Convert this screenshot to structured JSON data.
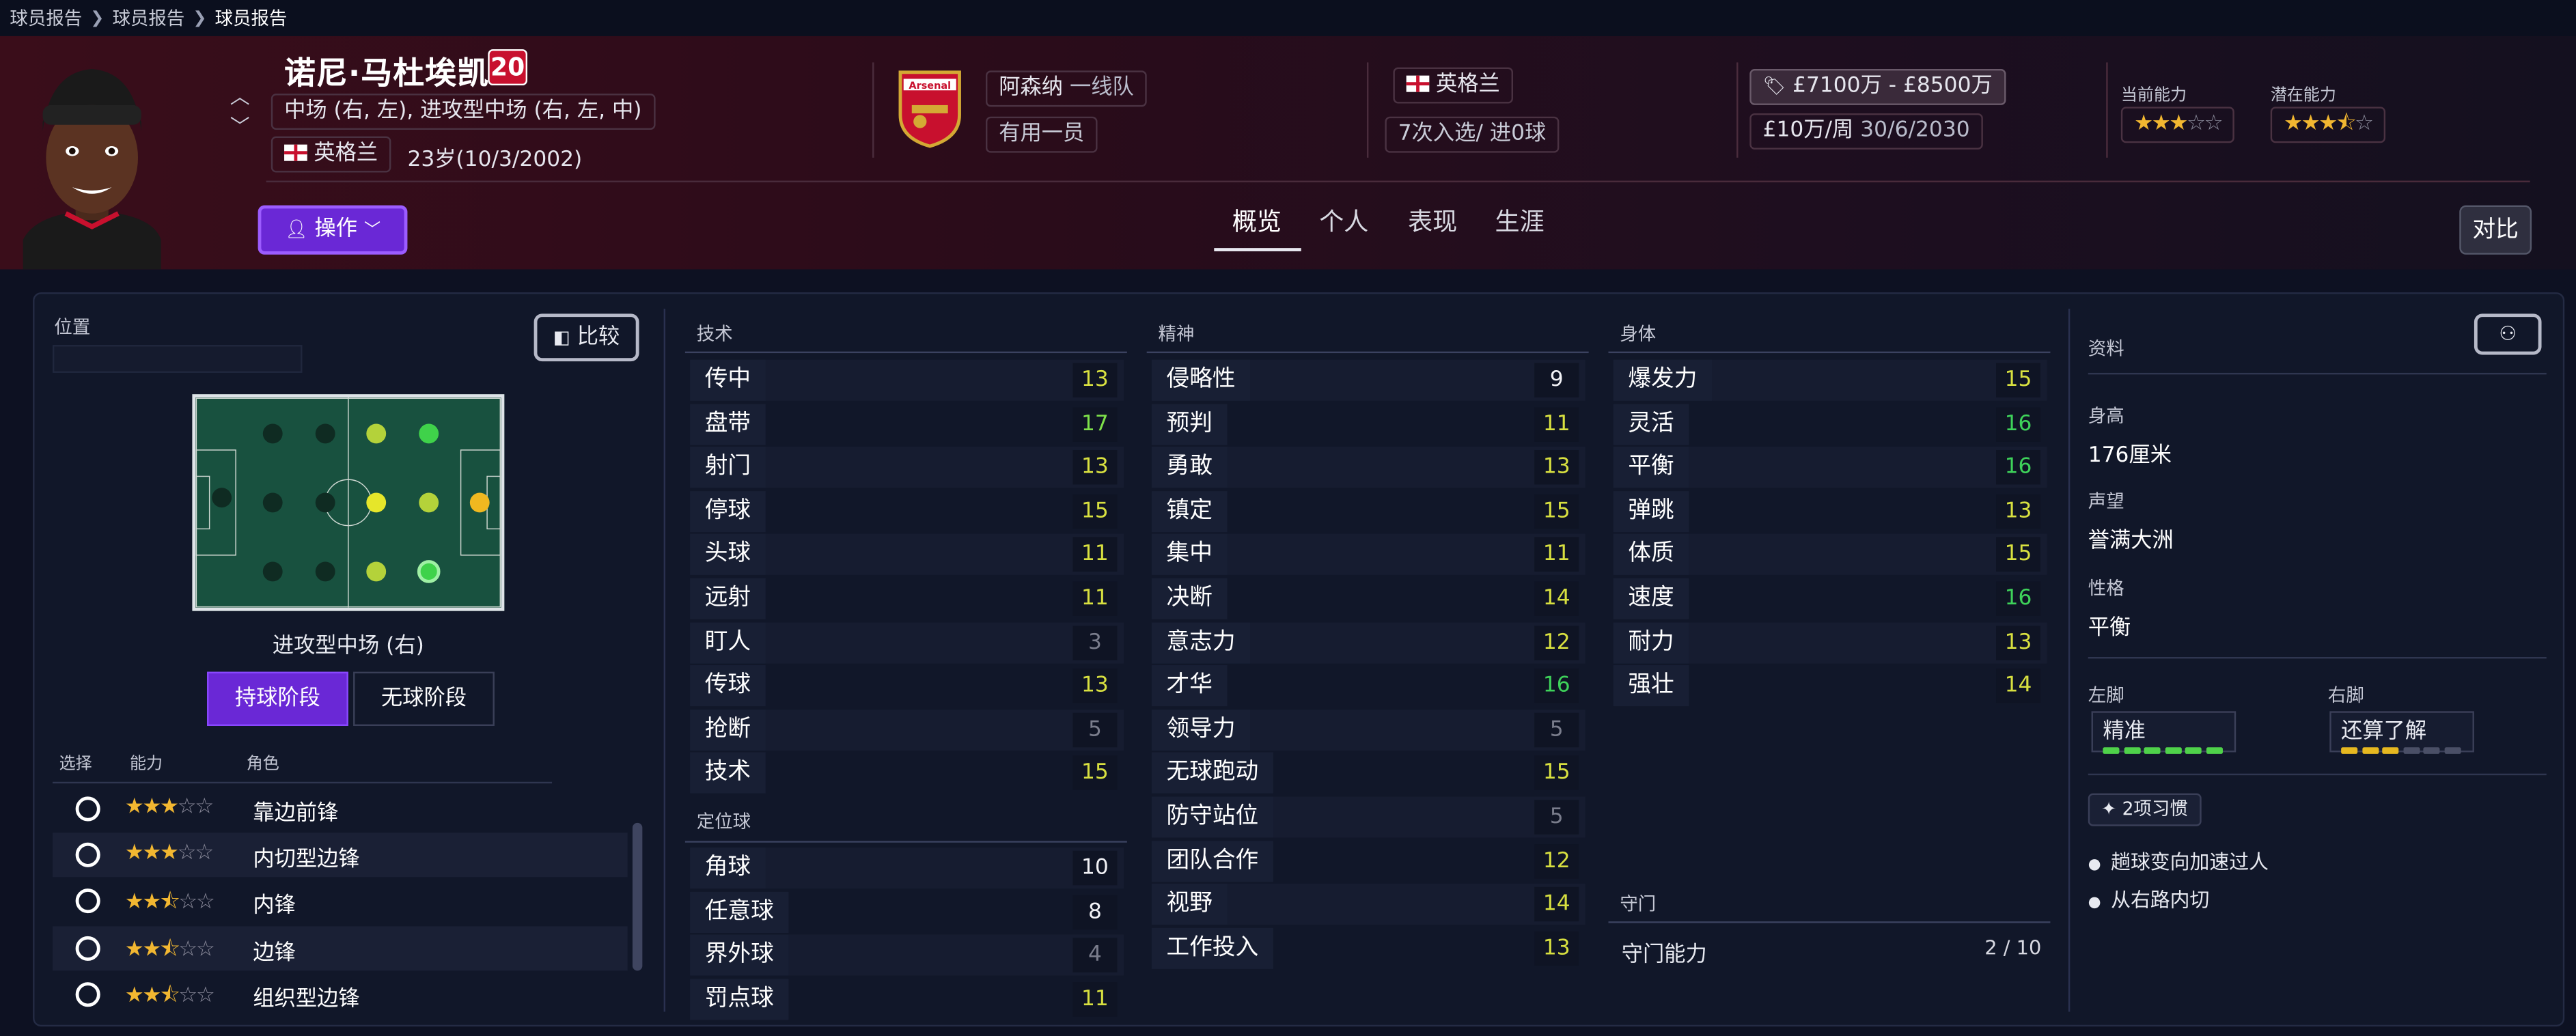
{
  "breadcrumb": [
    "球员报告",
    "球员报告",
    "球员报告"
  ],
  "player": {
    "name": "诺尼·马杜埃凯",
    "number": "20",
    "positions": "中场 (右, 左), 进攻型中场 (右, 左, 中)",
    "nationality": "英格兰",
    "age_dob": "23岁(10/3/2002)",
    "action_label": "操作"
  },
  "club": {
    "name": "阿森纳",
    "squad": "一线队",
    "role": "有用一员",
    "badge_text": "Arsenal"
  },
  "international": {
    "nation": "英格兰",
    "caps": "7次入选/ 进0球"
  },
  "value": {
    "range": "£7100万 - £8500万",
    "wage": "£10万/周",
    "contract_end": "30/6/2030"
  },
  "ability": {
    "current_label": "当前能力",
    "potential_label": "潜在能力",
    "current_stars": 3,
    "potential_stars": 3.5
  },
  "tabs": [
    "概览",
    "个人",
    "表现",
    "生涯"
  ],
  "compare_label": "对比",
  "position_panel": {
    "title": "位置",
    "compare_btn": "比较",
    "selected_position": "进攻型中场 (右)",
    "phase_in": "持球阶段",
    "phase_out": "无球阶段",
    "col_select": "选择",
    "col_ability": "能力",
    "col_role": "角色",
    "roles": [
      {
        "name": "靠边前锋",
        "stars": 3
      },
      {
        "name": "内切型边锋",
        "stars": 3
      },
      {
        "name": "内锋",
        "stars": 2.5
      },
      {
        "name": "边锋",
        "stars": 2.5
      },
      {
        "name": "组织型边锋",
        "stars": 2.5
      }
    ]
  },
  "technical": {
    "title": "技术",
    "items": [
      {
        "name": "传中",
        "value": "13",
        "tier": "y"
      },
      {
        "name": "盘带",
        "value": "17",
        "tier": "lg"
      },
      {
        "name": "射门",
        "value": "13",
        "tier": "y"
      },
      {
        "name": "停球",
        "value": "15",
        "tier": "y"
      },
      {
        "name": "头球",
        "value": "11",
        "tier": "y"
      },
      {
        "name": "远射",
        "value": "11",
        "tier": "y"
      },
      {
        "name": "盯人",
        "value": "3",
        "tier": "g"
      },
      {
        "name": "传球",
        "value": "13",
        "tier": "y"
      },
      {
        "name": "抢断",
        "value": "5",
        "tier": "g"
      },
      {
        "name": "技术",
        "value": "15",
        "tier": "y"
      }
    ]
  },
  "set_pieces": {
    "title": "定位球",
    "items": [
      {
        "name": "角球",
        "value": "10",
        "tier": "w"
      },
      {
        "name": "任意球",
        "value": "8",
        "tier": "w"
      },
      {
        "name": "界外球",
        "value": "4",
        "tier": "g"
      },
      {
        "name": "罚点球",
        "value": "11",
        "tier": "y"
      }
    ]
  },
  "mental": {
    "title": "精神",
    "items": [
      {
        "name": "侵略性",
        "value": "9",
        "tier": "w"
      },
      {
        "name": "预判",
        "value": "11",
        "tier": "y"
      },
      {
        "name": "勇敢",
        "value": "13",
        "tier": "y"
      },
      {
        "name": "镇定",
        "value": "15",
        "tier": "y"
      },
      {
        "name": "集中",
        "value": "11",
        "tier": "y"
      },
      {
        "name": "决断",
        "value": "14",
        "tier": "y"
      },
      {
        "name": "意志力",
        "value": "12",
        "tier": "y"
      },
      {
        "name": "才华",
        "value": "16",
        "tier": "gr"
      },
      {
        "name": "领导力",
        "value": "5",
        "tier": "g"
      },
      {
        "name": "无球跑动",
        "value": "15",
        "tier": "y"
      },
      {
        "name": "防守站位",
        "value": "5",
        "tier": "g"
      },
      {
        "name": "团队合作",
        "value": "12",
        "tier": "y"
      },
      {
        "name": "视野",
        "value": "14",
        "tier": "y"
      },
      {
        "name": "工作投入",
        "value": "13",
        "tier": "y"
      }
    ]
  },
  "physical": {
    "title": "身体",
    "items": [
      {
        "name": "爆发力",
        "value": "15",
        "tier": "y"
      },
      {
        "name": "灵活",
        "value": "16",
        "tier": "gr"
      },
      {
        "name": "平衡",
        "value": "16",
        "tier": "gr"
      },
      {
        "name": "弹跳",
        "value": "13",
        "tier": "y"
      },
      {
        "name": "体质",
        "value": "15",
        "tier": "y"
      },
      {
        "name": "速度",
        "value": "16",
        "tier": "gr"
      },
      {
        "name": "耐力",
        "value": "13",
        "tier": "y"
      },
      {
        "name": "强壮",
        "value": "14",
        "tier": "y"
      }
    ]
  },
  "goalkeeping": {
    "title": "守门",
    "label": "守门能力",
    "value": "2 / 10"
  },
  "info": {
    "title": "资料",
    "height_label": "身高",
    "height": "176厘米",
    "reputation_label": "声望",
    "reputation": "誉满大洲",
    "personality_label": "性格",
    "personality": "平衡",
    "left_foot_label": "左脚",
    "left_foot": "精准",
    "left_foot_level": 6,
    "right_foot_label": "右脚",
    "right_foot": "还算了解",
    "right_foot_level": 3,
    "traits_label": "2项习惯",
    "traits": [
      "趟球变向加速过人",
      "从右路内切"
    ]
  },
  "colors": {
    "accent": "#6a28d6",
    "header_bg": "#3a0d1a",
    "value_yellow": "#d8e040",
    "value_green": "#3ed25a",
    "star": "#f2b731"
  }
}
